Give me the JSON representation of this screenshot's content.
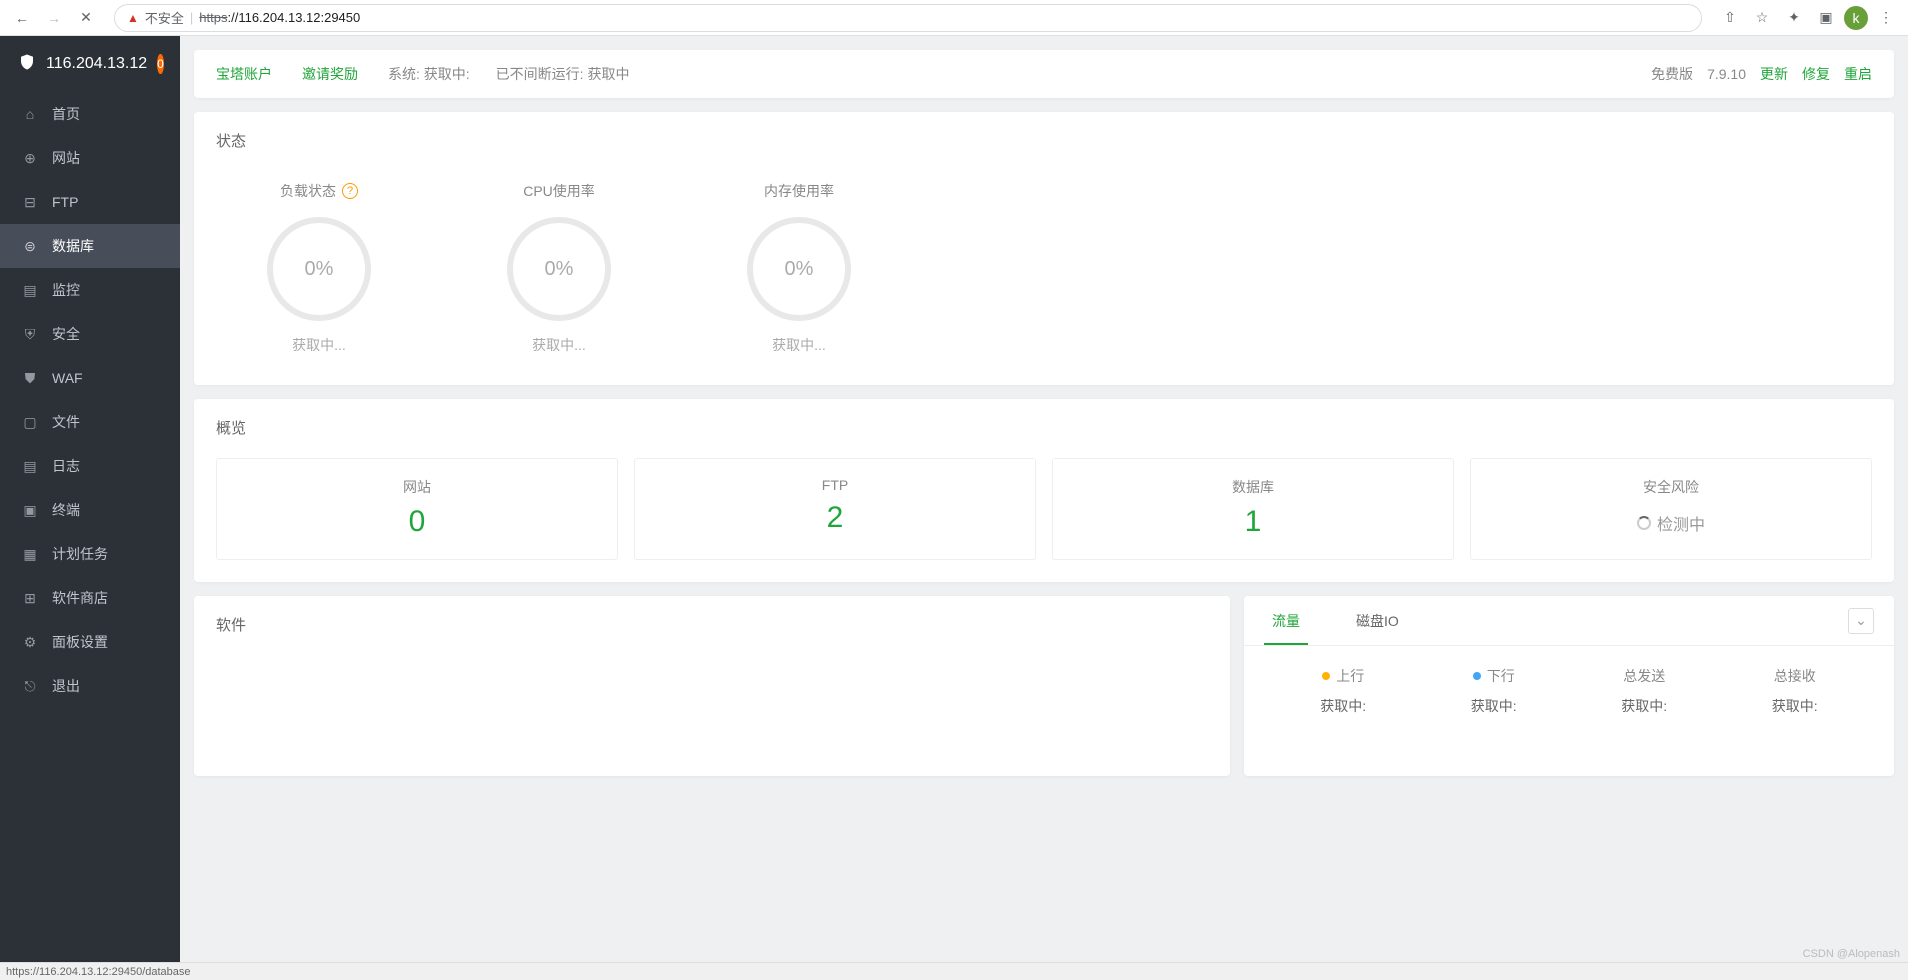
{
  "browser": {
    "insecure_label": "不安全",
    "url_https": "https",
    "url_rest": "://116.204.13.12:29450",
    "avatar_letter": "k"
  },
  "sidebar": {
    "header_ip": "116.204.13.12",
    "badge": "0",
    "items": [
      {
        "label": "首页"
      },
      {
        "label": "网站"
      },
      {
        "label": "FTP"
      },
      {
        "label": "数据库"
      },
      {
        "label": "监控"
      },
      {
        "label": "安全"
      },
      {
        "label": "WAF"
      },
      {
        "label": "文件"
      },
      {
        "label": "日志"
      },
      {
        "label": "终端"
      },
      {
        "label": "计划任务"
      },
      {
        "label": "软件商店"
      },
      {
        "label": "面板设置"
      },
      {
        "label": "退出"
      }
    ]
  },
  "topbar": {
    "account": "宝塔账户",
    "invite": "邀请奖励",
    "system_label": "系统:",
    "system_value": "获取中:",
    "uptime_label": "已不间断运行:",
    "uptime_value": "获取中",
    "version_label": "免费版",
    "version": "7.9.10",
    "update": "更新",
    "repair": "修复",
    "restart": "重启"
  },
  "status": {
    "title": "状态",
    "gauges": [
      {
        "label": "负载状态",
        "percent": "0%",
        "sub": "获取中...",
        "help": true
      },
      {
        "label": "CPU使用率",
        "percent": "0%",
        "sub": "获取中..."
      },
      {
        "label": "内存使用率",
        "percent": "0%",
        "sub": "获取中..."
      }
    ]
  },
  "overview": {
    "title": "概览",
    "cards": [
      {
        "title": "网站",
        "value": "0"
      },
      {
        "title": "FTP",
        "value": "2"
      },
      {
        "title": "数据库",
        "value": "1"
      },
      {
        "title": "安全风险",
        "value": "检测中",
        "loading": true
      }
    ]
  },
  "software": {
    "title": "软件"
  },
  "network": {
    "tabs": [
      {
        "label": "流量",
        "active": true
      },
      {
        "label": "磁盘IO"
      }
    ],
    "stats": [
      {
        "label": "上行",
        "dot": "orange",
        "value": "获取中:"
      },
      {
        "label": "下行",
        "dot": "blue",
        "value": "获取中:"
      },
      {
        "label": "总发送",
        "value": "获取中:"
      },
      {
        "label": "总接收",
        "value": "获取中:"
      }
    ]
  },
  "statusbar": {
    "url": "https://116.204.13.12:29450/database"
  },
  "watermark": "CSDN @Alopenash"
}
